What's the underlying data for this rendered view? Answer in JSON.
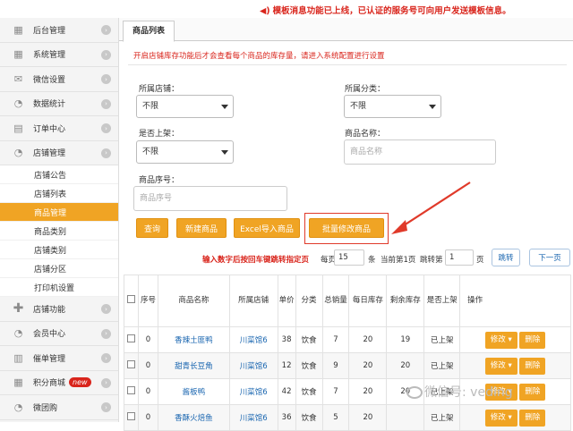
{
  "notice": {
    "text": "模板消息功能已上线，已认证的服务号可向用户发送模板信息。"
  },
  "sidebar": {
    "items": [
      {
        "label": "后台管理",
        "icon": "grid-icon"
      },
      {
        "label": "系统管理",
        "icon": "grid-icon"
      },
      {
        "label": "微信设置",
        "icon": "mail-icon"
      },
      {
        "label": "数据统计",
        "icon": "pie-chart-icon"
      },
      {
        "label": "订单中心",
        "icon": "cart-icon"
      },
      {
        "label": "店铺管理",
        "icon": "pie-chart-icon"
      }
    ],
    "sub_items": [
      "店铺公告",
      "店铺列表",
      "商品管理",
      "商品类别",
      "店铺类别",
      "店铺分区",
      "打印机设置"
    ],
    "items_after": [
      {
        "label": "店铺功能",
        "icon": "plus-icon"
      },
      {
        "label": "会员中心",
        "icon": "pie-chart-icon"
      },
      {
        "label": "催单管理",
        "icon": "printer-icon"
      },
      {
        "label": "积分商城",
        "icon": "grid-icon",
        "badge": "new"
      },
      {
        "label": "微团购",
        "icon": "pie-chart-icon"
      }
    ]
  },
  "tab": {
    "label": "商品列表"
  },
  "tip": "开启店铺库存功能后才会查看每个商品的库存量，请进入系统配置进行设置",
  "filters": {
    "store_label": "所属店铺：",
    "store_value": "不限",
    "category_label": "所属分类：",
    "category_value": "不限",
    "listed_label": "是否上架：",
    "listed_value": "不限",
    "name_label": "商品名称：",
    "name_placeholder": "商品名称",
    "serial_label": "商品序号：",
    "serial_placeholder": "商品序号"
  },
  "buttons": {
    "query": "查询",
    "new": "新建商品",
    "excel": "Excel导入商品",
    "batch": "批量修改商品"
  },
  "pager": {
    "hint": "输入数字后按回车键跳转指定页",
    "per_page_label": "每页",
    "per_page_value": "15",
    "per_page_unit": "条",
    "current": "当前第1页",
    "jump_label": "跳转第",
    "jump_value": "1",
    "jump_unit": "页",
    "jump_button": "跳转",
    "next_button": "下一页"
  },
  "table": {
    "headers": [
      "",
      "序号",
      "商品名称",
      "所属店铺",
      "单价",
      "分类",
      "总销量",
      "每日库存",
      "剩余库存",
      "是否上架",
      "操作"
    ],
    "rows": [
      {
        "seq": "0",
        "name": "香辣土匪鸭",
        "store": "川菜馆6",
        "price": "38",
        "category": "饮食",
        "sales": "7",
        "daily": "20",
        "remaining": "19",
        "status": "已上架"
      },
      {
        "seq": "0",
        "name": "甜青长豆角",
        "store": "川菜馆6",
        "price": "12",
        "category": "饮食",
        "sales": "9",
        "daily": "20",
        "remaining": "20",
        "status": "已上架"
      },
      {
        "seq": "0",
        "name": "酱板鸭",
        "store": "川菜馆6",
        "price": "42",
        "category": "饮食",
        "sales": "7",
        "daily": "20",
        "remaining": "20",
        "status": "已上架"
      },
      {
        "seq": "0",
        "name": "香酥火焙鱼",
        "store": "川菜馆6",
        "price": "36",
        "category": "饮食",
        "sales": "5",
        "daily": "20",
        "remaining": "",
        "status": "已上架"
      }
    ],
    "edit_label": "修改",
    "delete_label": "删除"
  },
  "watermark": "微信号: veding",
  "colors": {
    "accent": "#f0a424",
    "alert": "#d9251c",
    "link": "#1a66b0"
  }
}
